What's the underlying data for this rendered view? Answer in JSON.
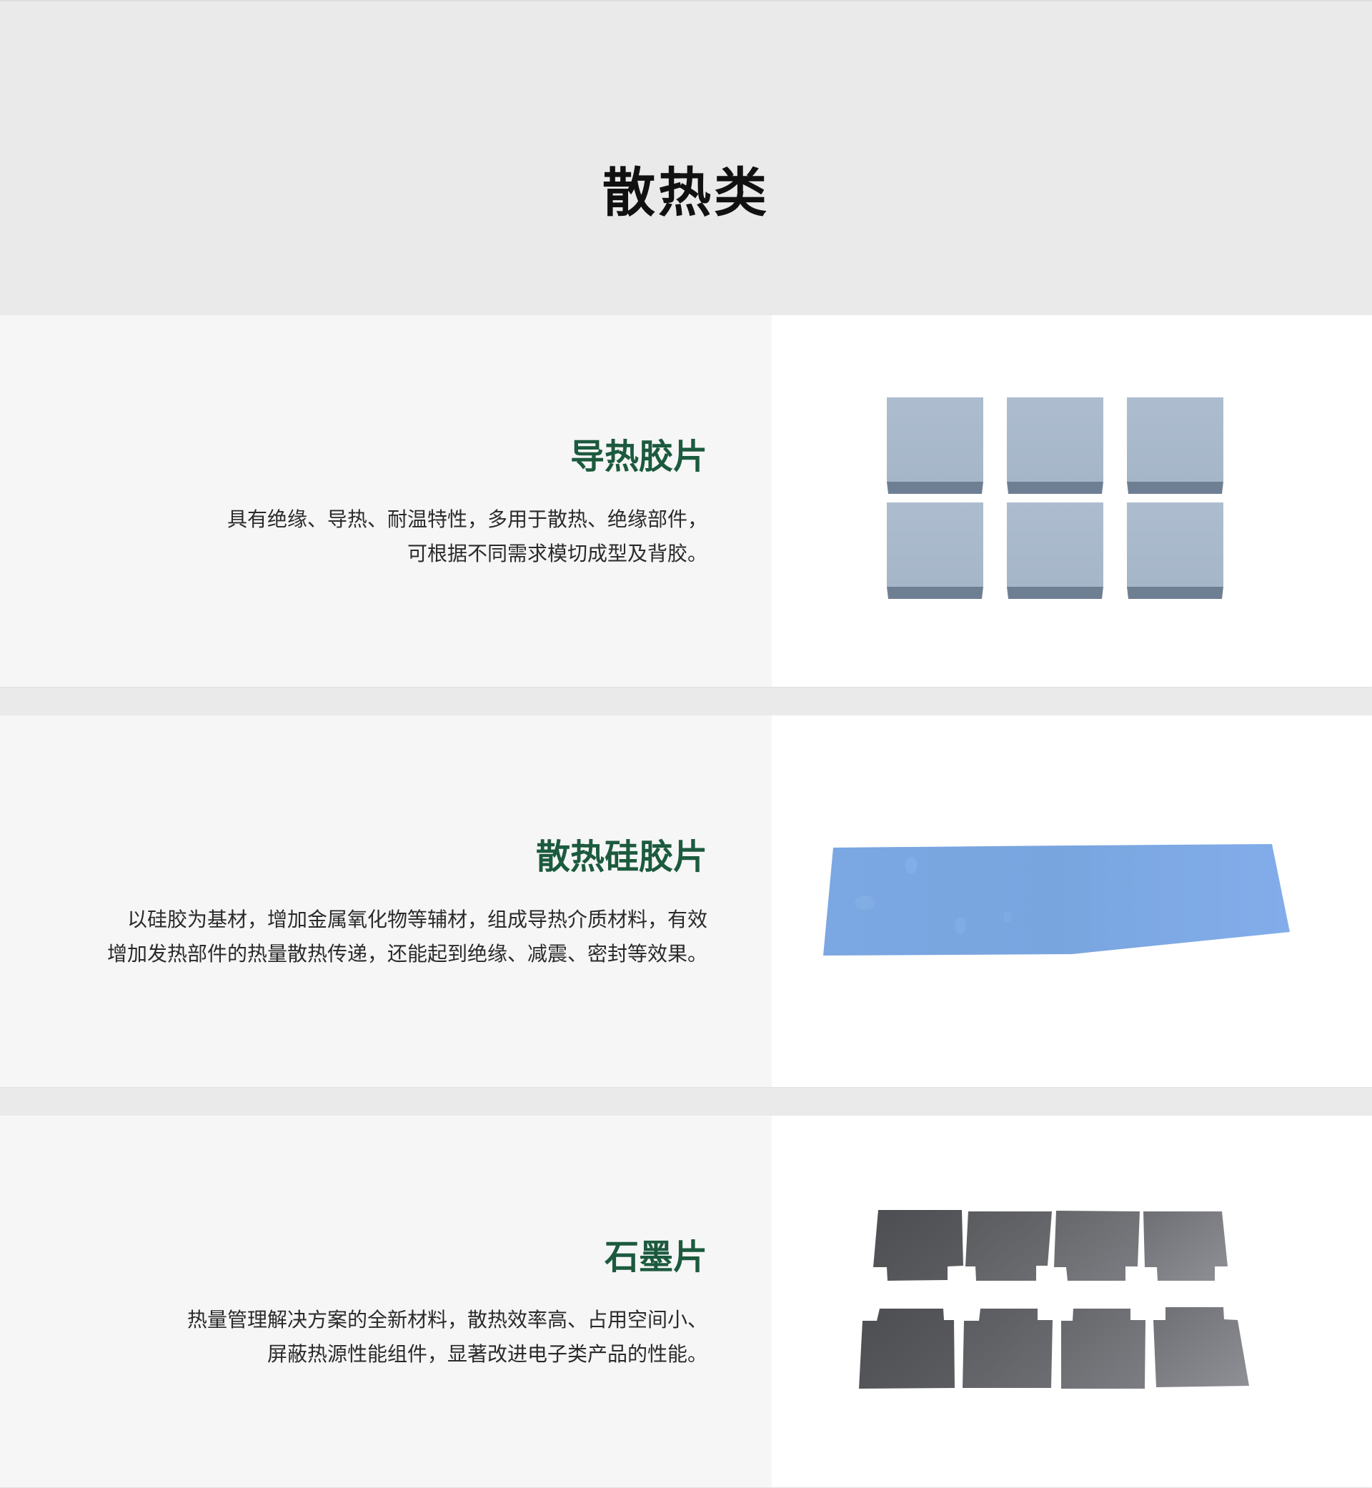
{
  "page": {
    "title": "散热类"
  },
  "products": [
    {
      "title": "导热胶片",
      "description_lines": [
        "具有绝缘、导热、耐温特性，多用于散热、绝缘部件，",
        "可根据不同需求模切成型及背胶。"
      ],
      "image_color": "#a9b9cc"
    },
    {
      "title": "散热硅胶片",
      "description_lines": [
        "以硅胶为基材，增加金属氧化物等辅材，组成导热介质材料，有效",
        "增加发热部件的热量散热传递，还能起到绝缘、减震、密封等效果。"
      ],
      "image_color": "#7aa6e0"
    },
    {
      "title": "石墨片",
      "description_lines": [
        "热量管理解决方案的全新材料，散热效率高、占用空间小、",
        "屏蔽热源性能组件，显著改进电子类产品的性能。"
      ],
      "image_color": "#4a4b4f"
    }
  ],
  "colors": {
    "title_green": "#1c5a3e",
    "background": "#eaeaea",
    "text_panel": "#f6f6f6"
  }
}
